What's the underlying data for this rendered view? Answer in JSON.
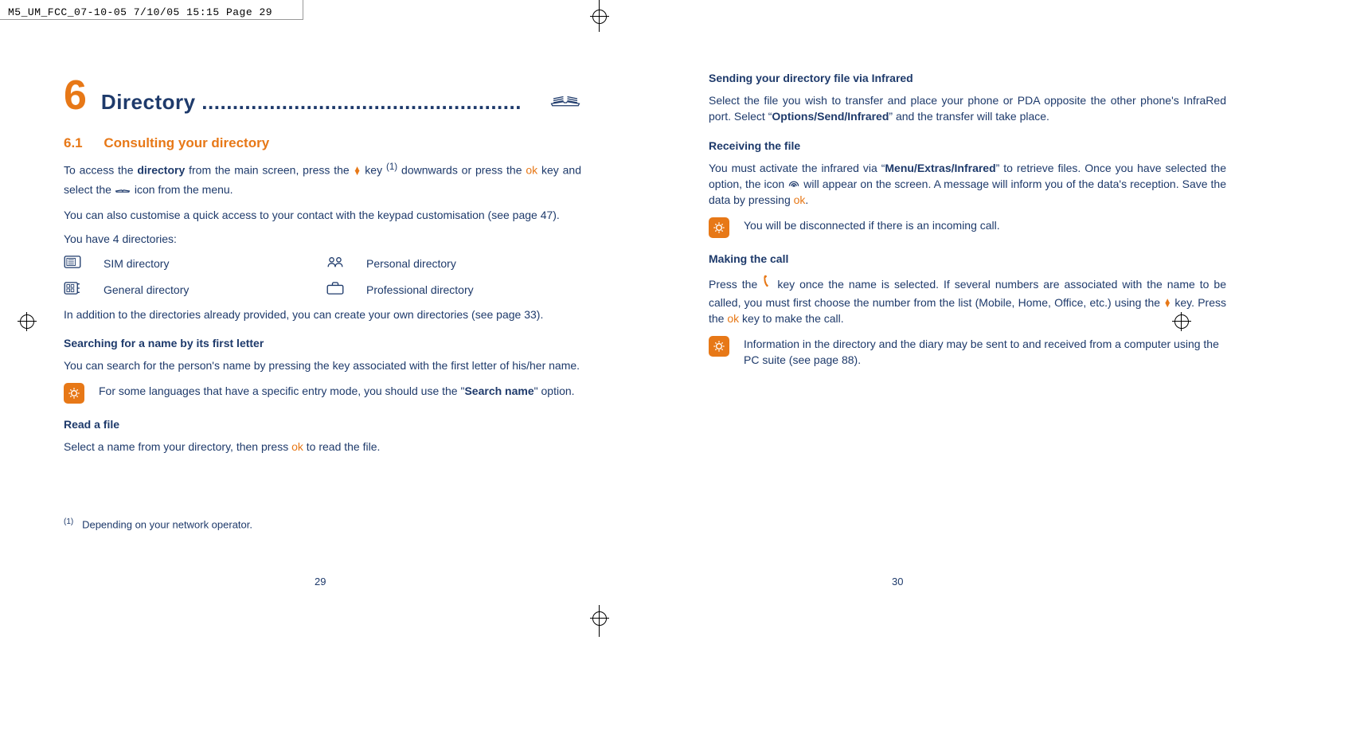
{
  "slug": "M5_UM_FCC_07-10-05  7/10/05  15:15  Page 29",
  "chapter": {
    "number": "6",
    "title": "Directory ....................................................",
    "section_number": "6.1",
    "section_title": "Consulting your directory"
  },
  "left": {
    "p1_a": "To access the ",
    "p1_b": "directory",
    "p1_c": " from the main screen, press the ",
    "p1_d": " key ",
    "p1_e": " downwards or press the ",
    "p1_f": " key and select the ",
    "p1_g": " icon from the menu.",
    "p2": "You can also customise a quick access to your contact with the keypad customisation (see page 47).",
    "p3": "You have 4 directories:",
    "dir1": "SIM directory",
    "dir2": "Personal directory",
    "dir3": "General directory",
    "dir4": "Professional directory",
    "p4": "In addition to the directories already provided, you can create your own directories (see page 33).",
    "sub1": "Searching for a name by its first letter",
    "p5": "You can search for the person's name by pressing the key associated with the first letter of his/her name.",
    "tip1": "For some languages that have a specific entry mode, you should use the “Search name” option.",
    "sub2": "Read a file",
    "p6_a": "Select a name from your directory, then press ",
    "p6_b": " to read the file.",
    "footnote_marker": "(1)",
    "footnote": "Depending on your network operator.",
    "sup1": "(1)",
    "pagenum": "29"
  },
  "right": {
    "sub1": "Sending your directory file via Infrared",
    "p1_a": "Select the file you wish to transfer and place your phone or PDA opposite the other phone's InfraRed port. Select “",
    "p1_b": "Options/Send/Infrared",
    "p1_c": "” and the transfer will take place.",
    "sub2": "Receiving the file",
    "p2_a": "You must activate the infrared via “",
    "p2_b": "Menu/Extras/Infrared",
    "p2_c": "” to retrieve files. Once you have selected the option, the icon ",
    "p2_d": " will appear on the screen. A message will inform you of the data's reception. Save the data by pressing ",
    "p2_e": ".",
    "tip1": "You will be disconnected if there is an incoming call.",
    "sub3": "Making the call",
    "p3_a": "Press the ",
    "p3_b": " key once the name is selected. If several numbers are associated with the name to be called, you must first choose the number from the list (Mobile, Home, Office, etc.) using the ",
    "p3_c": " key. Press the ",
    "p3_d": " key to make the call.",
    "tip2": "Information in the directory and the diary may be sent to and received from a computer using the PC suite (see page 88).",
    "pagenum": "30"
  },
  "glyphs": {
    "ok": "ok",
    "tip": "☀︎"
  }
}
